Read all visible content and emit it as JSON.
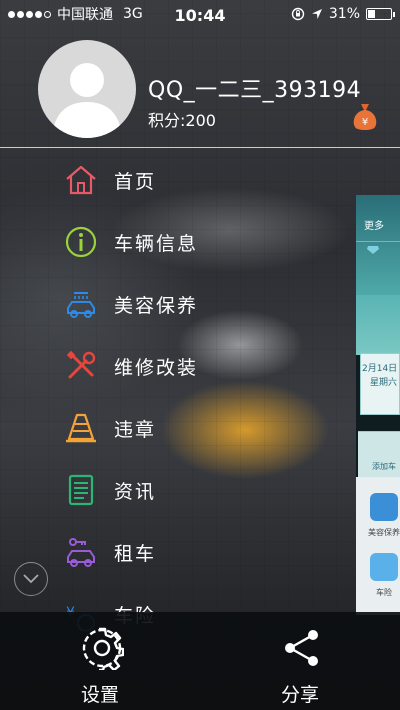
{
  "status_bar": {
    "carrier": "中国联通",
    "network": "3G",
    "time": "10:44",
    "battery": "31%",
    "battery_level": 0.31
  },
  "profile": {
    "username": "QQ_一二三_393194",
    "points": "积分:200"
  },
  "menu": {
    "items": [
      {
        "label": "首页",
        "icon": "home-icon",
        "color": "#e85a6a"
      },
      {
        "label": "车辆信息",
        "icon": "info-icon",
        "color": "#9bd23a"
      },
      {
        "label": "美容保养",
        "icon": "car-wash-icon",
        "color": "#2d8ae6"
      },
      {
        "label": "维修改装",
        "icon": "repair-tools-icon",
        "color": "#e8453c"
      },
      {
        "label": "违章",
        "icon": "traffic-cone-icon",
        "color": "#f2a33a"
      },
      {
        "label": "资讯",
        "icon": "news-icon",
        "color": "#2bb673"
      },
      {
        "label": "租车",
        "icon": "car-rental-icon",
        "color": "#9a5bd8"
      },
      {
        "label": "车险",
        "icon": "insurance-icon",
        "color": "#2d8ae6"
      }
    ]
  },
  "peek_panel": {
    "more": "更多",
    "date": "2月14日",
    "weekday": "星期六",
    "add_car": "添加车",
    "service_1": "美容保养",
    "service_2": "车险"
  },
  "bottom_bar": {
    "settings_label": "设置",
    "share_label": "分享"
  }
}
